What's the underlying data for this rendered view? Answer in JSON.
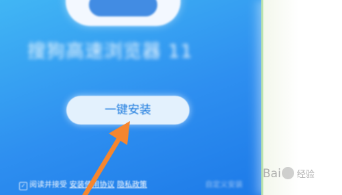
{
  "installer": {
    "app_title": "搜狗高速浏览器 11",
    "install_button": "一键安装",
    "agree": {
      "prefix": "阅读并接受",
      "license_link": "安装使用协议",
      "privacy_link": "隐私政策"
    },
    "custom_install": "自定义安装"
  },
  "watermark": {
    "brand_left": "Bai",
    "brand_right": "经验"
  },
  "colors": {
    "installer_gradient_start": "#41b6f4",
    "installer_gradient_end": "#1d7ae8",
    "button_bg": "#e3f1fd",
    "button_text": "#1979de",
    "annotation_arrow": "#f5862f"
  },
  "icons": {
    "logo": "sogou-browser-logo",
    "arrow": "orange-annotation-arrow",
    "checkbox": "checkbox-checked-icon",
    "paw": "baidu-paw-icon"
  }
}
